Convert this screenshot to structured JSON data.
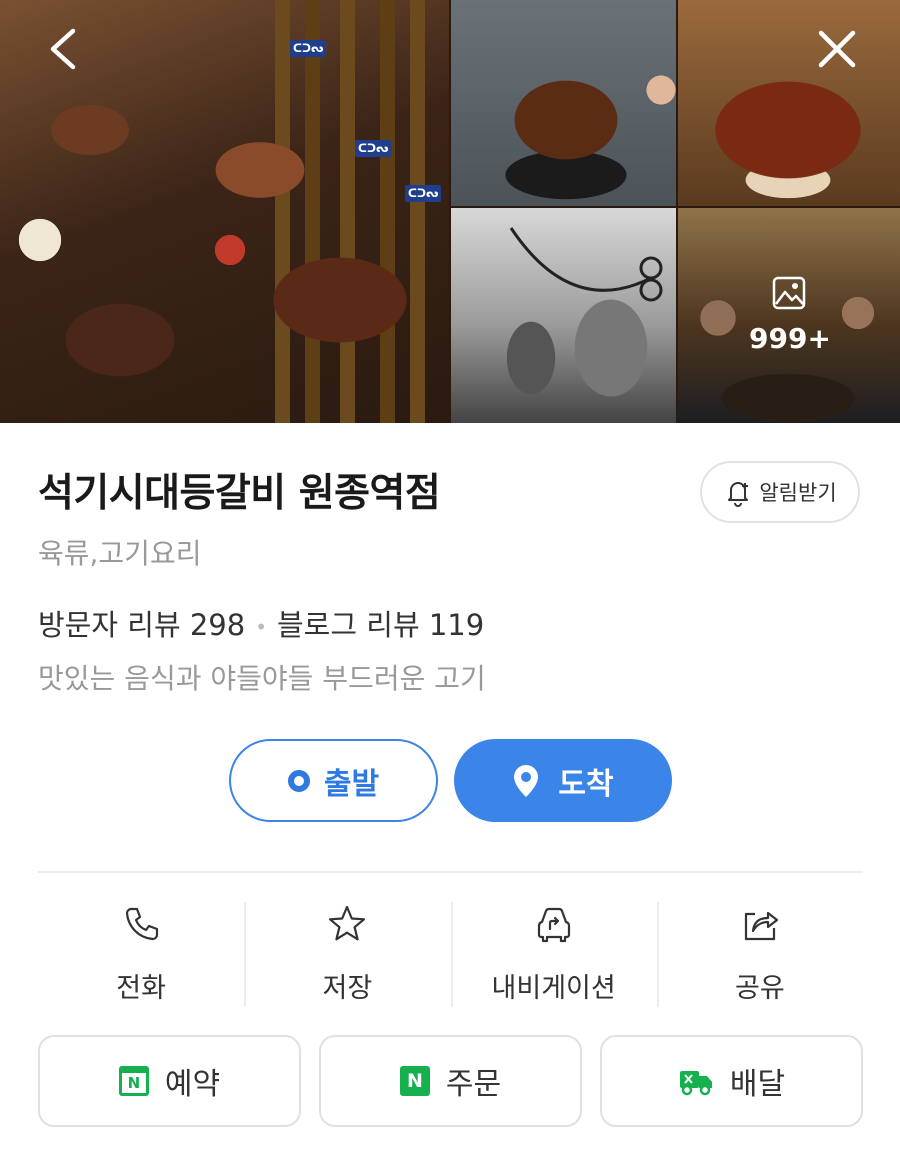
{
  "gallery": {
    "more_count": "999+",
    "icons": {
      "back": "chevron-left-icon",
      "close": "close-icon",
      "photos": "image-icon"
    }
  },
  "place": {
    "name": "석기시대등갈비 원종역점",
    "category": "육류,고기요리",
    "visitor_reviews_label": "방문자 리뷰 298",
    "blog_reviews_label": "블로그 리뷰 119",
    "description": "맛있는 음식과 야들야들 부드러운 고기",
    "alert_label": "알림받기"
  },
  "route": {
    "depart_label": "출발",
    "arrive_label": "도착",
    "accent_color": "#3b84e8"
  },
  "actions": [
    {
      "label": "전화",
      "icon": "phone-icon"
    },
    {
      "label": "저장",
      "icon": "star-icon"
    },
    {
      "label": "내비게이션",
      "icon": "car-navigation-icon"
    },
    {
      "label": "공유",
      "icon": "share-icon"
    }
  ],
  "external": [
    {
      "label": "예약",
      "icon": "naver-calendar-icon"
    },
    {
      "label": "주문",
      "icon": "naver-n-icon",
      "badge": "N"
    },
    {
      "label": "배달",
      "icon": "delivery-truck-icon"
    }
  ],
  "brand_green": "#16b04f"
}
